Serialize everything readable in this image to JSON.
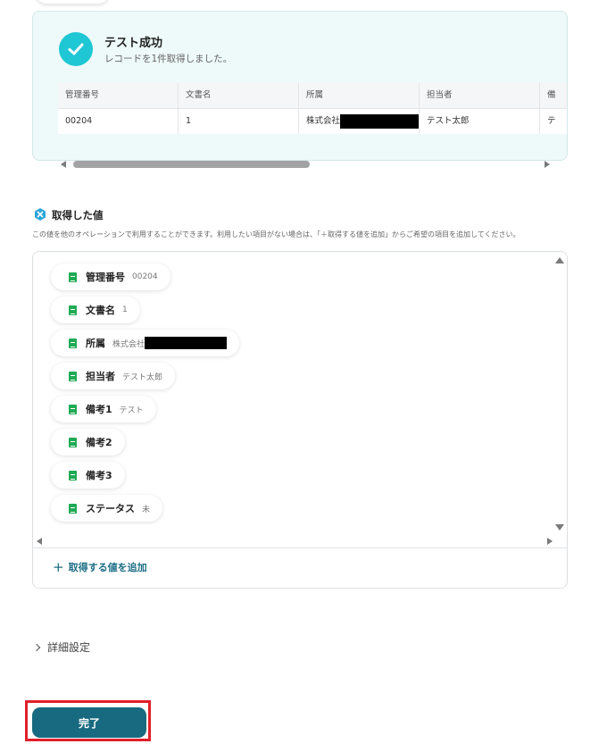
{
  "success": {
    "title": "テスト成功",
    "subtitle": "レコードを1件取得しました。"
  },
  "result_table": {
    "headers": [
      "管理番号",
      "文書名",
      "所属",
      "担当者",
      "備"
    ],
    "row": [
      "00204",
      "1",
      "株式会社",
      "テスト太郎",
      "テ"
    ]
  },
  "acquired": {
    "title": "取得した値",
    "description": "この値を他のオペレーションで利用することができます。利用したい項目がない場合は、「＋取得する値を追加」からご希望の項目を追加してください。",
    "items": [
      {
        "label": "管理番号",
        "value": "00204"
      },
      {
        "label": "文書名",
        "value": "1"
      },
      {
        "label": "所属",
        "value": "株式会社"
      },
      {
        "label": "担当者",
        "value": "テスト太郎"
      },
      {
        "label": "備考1",
        "value": "テスト"
      },
      {
        "label": "備考2",
        "value": ""
      },
      {
        "label": "備考3",
        "value": ""
      },
      {
        "label": "ステータス",
        "value": "未"
      }
    ],
    "add_label": "取得する値を追加",
    "add_icon": "+"
  },
  "details_label": "詳細設定",
  "done_label": "完了",
  "colors": {
    "accent": "#176a80",
    "check": "#1fc7d4",
    "sheet_icon": "#1faa54",
    "highlight": "#e0202a"
  }
}
